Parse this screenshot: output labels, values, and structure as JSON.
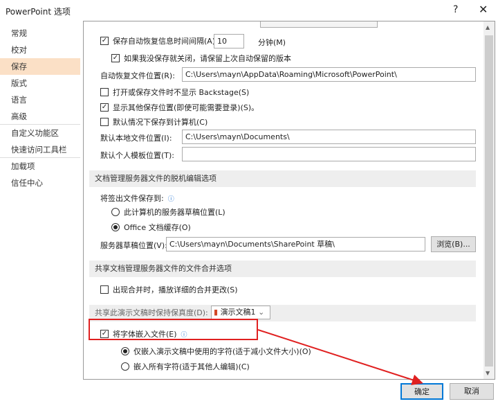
{
  "window": {
    "title": "PowerPoint 选项",
    "help": "?",
    "close": "✕"
  },
  "sidebar": {
    "items": [
      "常规",
      "校对",
      "保存",
      "版式",
      "语言",
      "高级",
      "自定义功能区",
      "快速访问工具栏",
      "加载项",
      "信任中心"
    ]
  },
  "save": {
    "autorecover_interval_label": "保存自动恢复信息时间间隔(A)",
    "autorecover_interval_value": "10",
    "minutes_label": "分钟(M)",
    "keep_last_label": "如果我没保存就关闭，请保留上次自动保留的版本",
    "autorecover_location_label": "自动恢复文件位置(R):",
    "autorecover_location_value": "C:\\Users\\mayn\\AppData\\Roaming\\Microsoft\\PowerPoint\\",
    "no_backstage_label": "打开或保存文件时不显示 Backstage(S)",
    "show_other_label": "显示其他保存位置(即使可能需要登录)(S)。",
    "save_to_computer_label": "默认情况下保存到计算机(C)",
    "default_local_label": "默认本地文件位置(I):",
    "default_local_value": "C:\\Users\\mayn\\Documents\\",
    "template_label": "默认个人模板位置(T):",
    "template_value": ""
  },
  "offline": {
    "header": "文档管理服务器文件的脱机编辑选项",
    "save_to_label": "将签出文件保存到:",
    "opt_server": "此计算机的服务器草稿位置(L)",
    "opt_cache": "Office 文档缓存(O)",
    "drafts_label": "服务器草稿位置(V):",
    "drafts_value": "C:\\Users\\mayn\\Documents\\SharePoint 草稿\\",
    "browse": "浏览(B)..."
  },
  "merge": {
    "header": "共享文档管理服务器文件的文件合并选项",
    "show_changes": "出现合并时，播放详细的合并更改(S)"
  },
  "fidelity": {
    "header": "共享此演示文稿时保持保真度(D):",
    "doc": "演示文稿1",
    "embed_fonts": "将字体嵌入文件(E)",
    "embed_used": "仅嵌入演示文稿中使用的字符(适于减小文件大小)(O)",
    "embed_all": "嵌入所有字符(适于其他人编辑)(C)"
  },
  "footer": {
    "ok": "确定",
    "cancel": "取消"
  },
  "colors": {
    "annotation": "#e02020",
    "selected": "#fbe0c6"
  }
}
